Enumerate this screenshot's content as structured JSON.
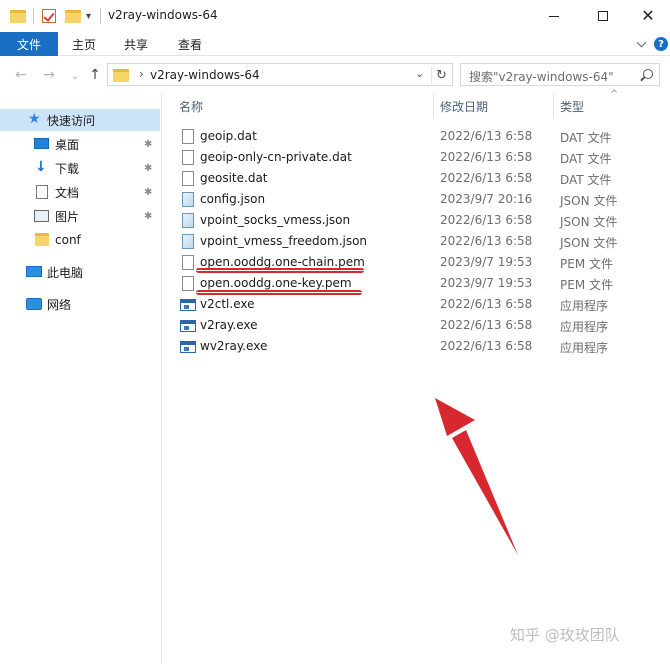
{
  "window": {
    "title": "v2ray-windows-64",
    "controls": {
      "minimize": "minimize-icon",
      "maximize": "maximize-icon",
      "close": "✕"
    }
  },
  "ribbon": {
    "tabs": [
      "文件",
      "主页",
      "共享",
      "查看"
    ],
    "help": "?"
  },
  "nav": {
    "back": "←",
    "forward": "→",
    "recent": "⌄",
    "up": "↑",
    "address_chevron": "›",
    "address": "v2ray-windows-64",
    "address_dropdown": "⌄",
    "refresh": "↻",
    "search_placeholder": "搜索\"v2ray-windows-64\""
  },
  "sidebar": {
    "items": [
      {
        "label": "快速访问",
        "icon": "star-icon",
        "pinned": false,
        "active": true
      },
      {
        "label": "桌面",
        "icon": "desktop-icon",
        "pinned": true
      },
      {
        "label": "下载",
        "icon": "download-icon",
        "pinned": true
      },
      {
        "label": "文档",
        "icon": "document-icon",
        "pinned": true
      },
      {
        "label": "图片",
        "icon": "picture-icon",
        "pinned": true
      },
      {
        "label": "conf",
        "icon": "folder-icon",
        "pinned": false
      },
      {
        "label": "此电脑",
        "icon": "computer-icon",
        "pinned": false
      },
      {
        "label": "网络",
        "icon": "network-icon",
        "pinned": false
      }
    ],
    "pin_glyph": "📌"
  },
  "columns": {
    "name": "名称",
    "date": "修改日期",
    "type": "类型",
    "sort_glyph": "^"
  },
  "files": [
    {
      "name": "geoip.dat",
      "date": "2022/6/13 6:58",
      "type": "DAT 文件",
      "icon": "file-icon"
    },
    {
      "name": "geoip-only-cn-private.dat",
      "date": "2022/6/13 6:58",
      "type": "DAT 文件",
      "icon": "file-icon"
    },
    {
      "name": "geosite.dat",
      "date": "2022/6/13 6:58",
      "type": "DAT 文件",
      "icon": "file-icon"
    },
    {
      "name": "config.json",
      "date": "2023/9/7 20:16",
      "type": "JSON 文件",
      "icon": "json-file-icon"
    },
    {
      "name": "vpoint_socks_vmess.json",
      "date": "2022/6/13 6:58",
      "type": "JSON 文件",
      "icon": "json-file-icon"
    },
    {
      "name": "vpoint_vmess_freedom.json",
      "date": "2022/6/13 6:58",
      "type": "JSON 文件",
      "icon": "json-file-icon"
    },
    {
      "name": "open.ooddg.one-chain.pem",
      "date": "2023/9/7 19:53",
      "type": "PEM 文件",
      "icon": "file-icon",
      "highlighted": true
    },
    {
      "name": "open.ooddg.one-key.pem",
      "date": "2023/9/7 19:53",
      "type": "PEM 文件",
      "icon": "file-icon",
      "highlighted": true
    },
    {
      "name": "v2ctl.exe",
      "date": "2022/6/13 6:58",
      "type": "应用程序",
      "icon": "app-icon"
    },
    {
      "name": "v2ray.exe",
      "date": "2022/6/13 6:58",
      "type": "应用程序",
      "icon": "app-icon"
    },
    {
      "name": "wv2ray.exe",
      "date": "2022/6/13 6:58",
      "type": "应用程序",
      "icon": "app-icon"
    }
  ],
  "colors": {
    "accent": "#1a6fc4",
    "annotation": "#d7282f",
    "selection": "#cce4f7"
  },
  "watermark": "知乎 @玫玫团队"
}
